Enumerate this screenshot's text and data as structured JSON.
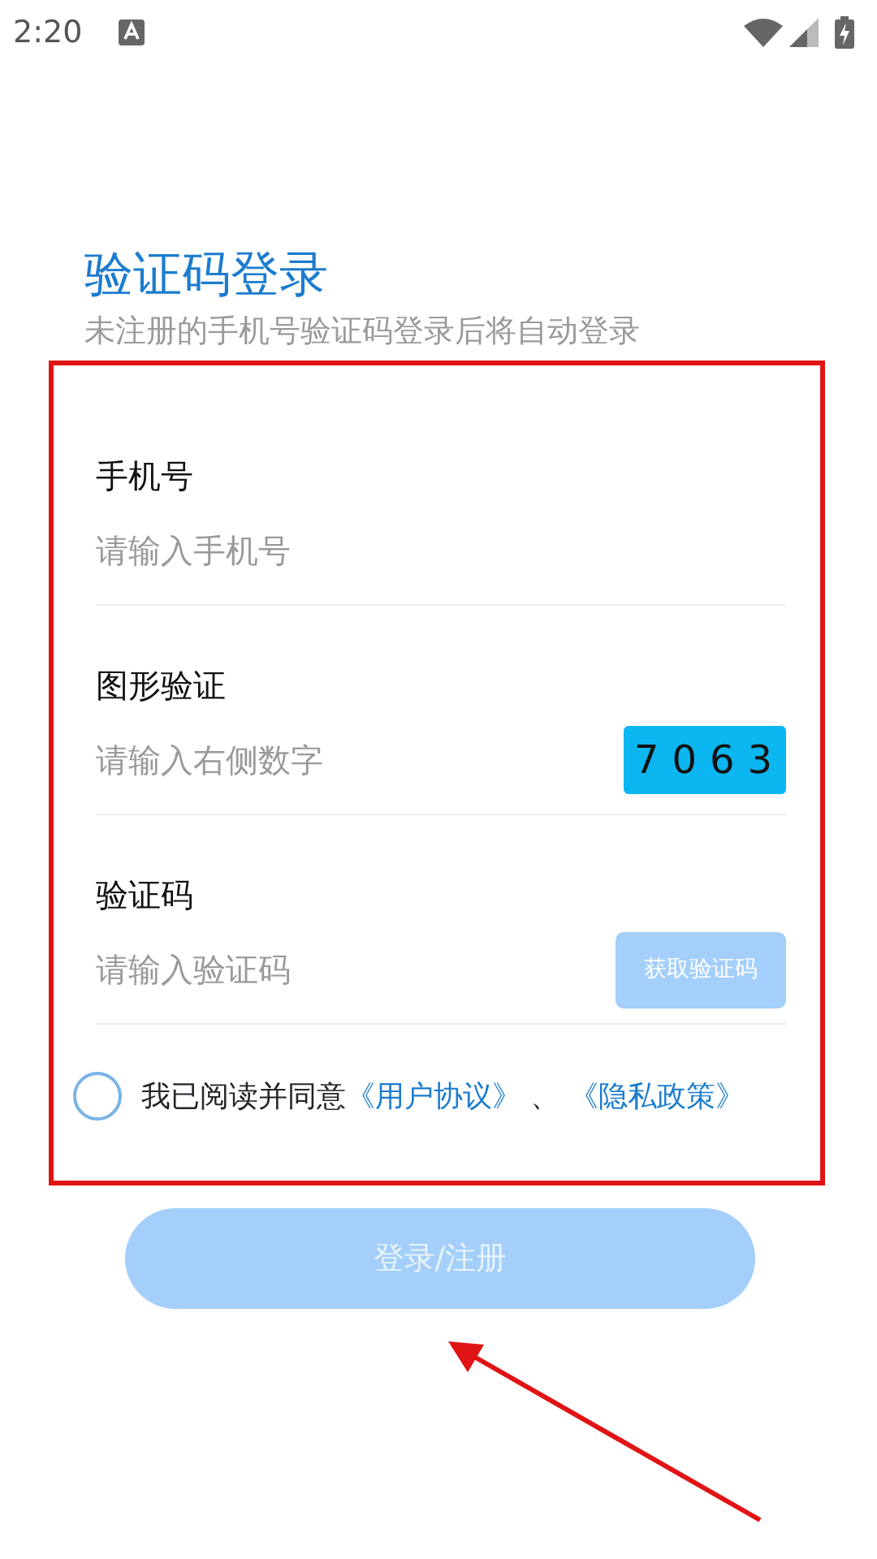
{
  "status_bar": {
    "time": "2:20"
  },
  "title": "验证码登录",
  "subtitle": "未注册的手机号验证码登录后将自动登录",
  "fields": [
    {
      "kind": "text",
      "label": "手机号",
      "placeholder": "请输入手机号"
    },
    {
      "kind": "captcha",
      "label": "图形验证",
      "placeholder": "请输入右侧数字",
      "captcha": "7063"
    },
    {
      "kind": "sms",
      "label": "验证码",
      "placeholder": "请输入验证码",
      "button": "获取验证码"
    }
  ],
  "agreement": {
    "checked": false,
    "text": "我已阅读并同意",
    "links": [
      "《用户协议》",
      "《隐私政策》"
    ],
    "separator": "、"
  },
  "login_button": {
    "label": "登录/注册",
    "disabled": true
  },
  "annotations": {
    "highlight_frame": true,
    "arrow": true
  }
}
